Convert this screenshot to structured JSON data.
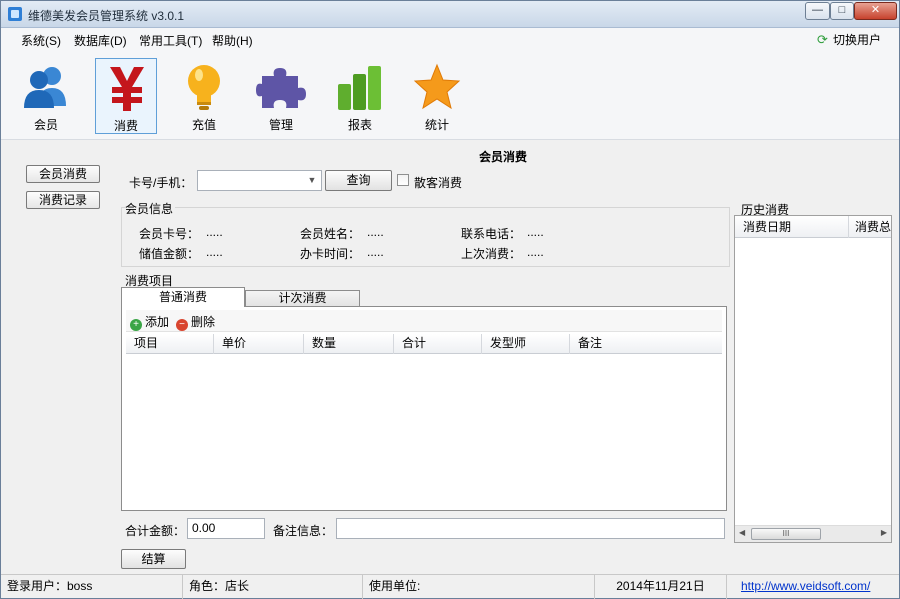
{
  "window": {
    "title": "维德美发会员管理系统 v3.0.1",
    "controls": {
      "minimize": "—",
      "maximize": "□",
      "close": "✕"
    }
  },
  "menu": {
    "items": [
      "系统(S)",
      "数据库(D)",
      "常用工具(T)",
      "帮助(H)"
    ],
    "switch_user": "切换用户",
    "switch_user_icon": "refresh-icon"
  },
  "toolbar": {
    "items": [
      {
        "label": "会员",
        "icon": "members-icon",
        "selected": false
      },
      {
        "label": "消费",
        "icon": "yen-icon",
        "selected": true
      },
      {
        "label": "充值",
        "icon": "lightbulb-icon",
        "selected": false
      },
      {
        "label": "管理",
        "icon": "puzzle-icon",
        "selected": false
      },
      {
        "label": "报表",
        "icon": "bar-chart-icon",
        "selected": false
      },
      {
        "label": "统计",
        "icon": "star-icon",
        "selected": false
      }
    ]
  },
  "left_nav": {
    "member_consume": "会员消费",
    "consume_records": "消费记录"
  },
  "page": {
    "title": "会员消费"
  },
  "search": {
    "label": "卡号/手机：",
    "value": "",
    "query_button": "查询",
    "guest_checkbox_label": "散客消费",
    "guest_checked": false
  },
  "member_info": {
    "title": "会员信息",
    "card_no_label": "会员卡号：",
    "card_no": ".....",
    "name_label": "会员姓名：",
    "name": ".....",
    "phone_label": "联系电话：",
    "phone": ".....",
    "balance_label": "储值金额：",
    "balance": ".....",
    "open_date_label": "办卡时间：",
    "open_date": ".....",
    "last_consume_label": "上次消费：",
    "last_consume": "....."
  },
  "consume_items": {
    "title": "消费项目",
    "tabs": [
      "普通消费",
      "计次消费"
    ],
    "active_tab": 0,
    "add_label": "添加",
    "delete_label": "删除",
    "columns": [
      "项目",
      "单价",
      "数量",
      "合计",
      "发型师",
      "备注"
    ],
    "rows": []
  },
  "totals": {
    "total_label": "合计金额：",
    "total_value": "0.00",
    "note_label": "备注信息：",
    "note_value": "",
    "checkout_button": "结算"
  },
  "history": {
    "title": "历史消费",
    "columns": [
      "消费日期",
      "消费总"
    ],
    "scroll_thumb": "III"
  },
  "status": {
    "user": "登录用户：boss",
    "role": "角色：店长",
    "unit": "使用单位:",
    "date": "2014年11月21日",
    "link": "http://www.veidsoft.com/"
  }
}
